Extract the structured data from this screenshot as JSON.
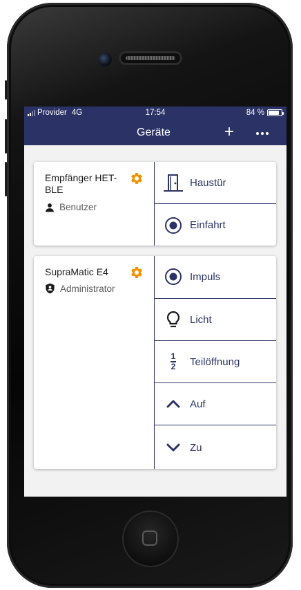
{
  "status_bar": {
    "carrier": "Provider",
    "network": "4G",
    "time": "17:54",
    "battery": "84 %",
    "battery_level": 0.84
  },
  "nav_bar": {
    "title": "Geräte",
    "add_icon": "plus-icon",
    "more_icon": "more-icon"
  },
  "devices": [
    {
      "name": "Empfänger HET-BLE",
      "role": "Benutzer",
      "role_icon": "user-icon",
      "settings_icon": "gear-icon",
      "actions": [
        {
          "label": "Haustür",
          "icon": "door-icon"
        },
        {
          "label": "Einfahrt",
          "icon": "impulse-icon"
        }
      ]
    },
    {
      "name": "SupraMatic E4",
      "role": "Administrator",
      "role_icon": "shield-icon",
      "settings_icon": "gear-icon",
      "actions": [
        {
          "label": "Impuls",
          "icon": "impulse-icon"
        },
        {
          "label": "Licht",
          "icon": "light-bulb-icon"
        },
        {
          "label": "Teilöffnung",
          "icon": "half-fraction-icon",
          "icon_text": [
            "1",
            "2"
          ]
        },
        {
          "label": "Auf",
          "icon": "chevron-up-icon"
        },
        {
          "label": "Zu",
          "icon": "chevron-down-icon"
        }
      ]
    }
  ],
  "colors": {
    "primary": "#2b3366",
    "accent": "#f39200",
    "background": "#f2f2f3",
    "card": "#ffffff"
  }
}
